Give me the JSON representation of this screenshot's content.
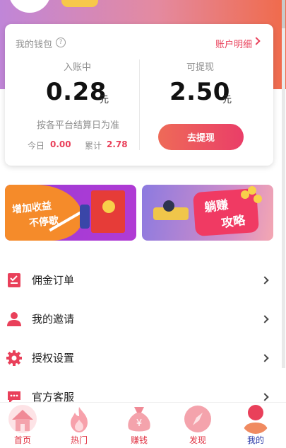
{
  "wallet": {
    "title": "我的钱包",
    "help_icon": "question-circle-icon",
    "account_link": "账户明细",
    "pending": {
      "label": "入账中",
      "amount": "0.28",
      "unit": "元",
      "note": "按各平台结算日为准",
      "today_label": "今日",
      "today_value": "0.00",
      "total_label": "累计",
      "total_value": "2.78"
    },
    "withdrawable": {
      "label": "可提现",
      "amount": "2.50",
      "unit": "元",
      "button": "去提现"
    }
  },
  "banners": [
    {
      "name": "income-banner",
      "lines": [
        "增加收益",
        "不停歇"
      ]
    },
    {
      "name": "earn-strategy-banner",
      "lines": [
        "躺赚",
        "攻略"
      ]
    }
  ],
  "menu": [
    {
      "label": "佣金订单",
      "icon": "order-list-icon"
    },
    {
      "label": "我的邀请",
      "icon": "user-icon"
    },
    {
      "label": "授权设置",
      "icon": "gear-icon"
    },
    {
      "label": "官方客服",
      "icon": "chat-bubble-icon"
    }
  ],
  "tabbar": [
    {
      "label": "首页",
      "icon": "home-icon"
    },
    {
      "label": "热门",
      "icon": "flame-icon"
    },
    {
      "label": "赚钱",
      "icon": "money-bag-icon"
    },
    {
      "label": "发现",
      "icon": "compass-icon"
    },
    {
      "label": "我的",
      "icon": "person-icon",
      "active": true
    }
  ],
  "colors": {
    "accent": "#e9405a",
    "tab_inactive": "#e03040",
    "tab_active": "#2a3aa8",
    "gradient_start": "#c086d8",
    "gradient_end": "#f06a4a"
  }
}
